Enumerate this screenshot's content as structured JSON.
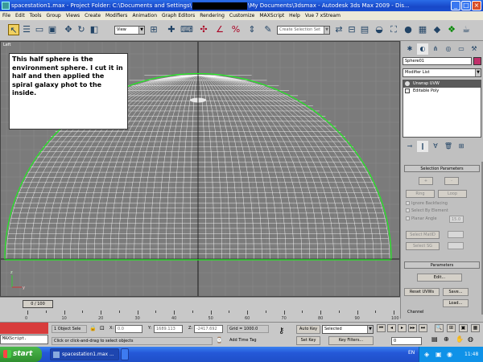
{
  "window": {
    "title_prefix": "spacestation1.max    - Project Folder: C:\\Documents and Settings\\",
    "title_suffix": "\\My Documents\\3dsmax    - Autodesk 3ds Max  2009    - Dis..."
  },
  "menu": [
    "File",
    "Edit",
    "Tools",
    "Group",
    "Views",
    "Create",
    "Modifiers",
    "Animation",
    "Graph Editors",
    "Rendering",
    "Customize",
    "MAXScript",
    "Help",
    "Vue 7 xStream"
  ],
  "toolbar": {
    "ref_coord": "View",
    "named_selection": "Create Selection Set"
  },
  "viewport": {
    "label": "Left",
    "note": "This half sphere is the environment sphere. I cut it in half and then applied the spiral galaxy phot to the inside.",
    "wire_color": "#ffffff",
    "bbox_color": "#22ee22",
    "grid_color": "#8c8c8c",
    "axis_color": "#000000"
  },
  "panel": {
    "object_name": "Sphere01",
    "color_swatch": "#c0306a",
    "modifier_list": "Modifier List",
    "stack": [
      "Unwrap UVW",
      "Editable Poly"
    ],
    "selection_params": "Selection Parameters",
    "ring": "Ring",
    "loop": "Loop",
    "ignore_backfacing": "Ignore Backfacing",
    "select_by_element": "Select By Element",
    "planar_angle": "Planar Angle",
    "planar_value": "15.0",
    "select_matid": "Select MatID",
    "select_sg": "Select SG",
    "parameters": "Parameters",
    "edit": "Edit...",
    "reset_uvws": "Reset UVWs",
    "save": "Save...",
    "load": "Load...",
    "channel": "Channel"
  },
  "timeline": {
    "slider": "0 / 100",
    "ticks": [
      "0",
      "10",
      "20",
      "30",
      "40",
      "50",
      "60",
      "70",
      "80",
      "90",
      "100"
    ]
  },
  "status": {
    "maxscript": "MAXScript.",
    "selection": "1 Object Sele",
    "x_label": "X:",
    "x_value": "0.0",
    "y_label": "Y:",
    "y_value": "1689.113",
    "z_label": "Z:",
    "z_value": "-2417.692",
    "grid": "Grid = 1000.0",
    "auto_key": "Auto Key",
    "set_key": "Set Key",
    "key_mode": "Selected",
    "key_filters": "Key Filters...",
    "prompt": "Click or click-and-drag to select objects",
    "add_time_tag": "Add Time Tag",
    "frame": "0"
  },
  "taskbar": {
    "start": "start",
    "tasks": [
      "spacestation1.max ...",
      ""
    ],
    "lang": "EN",
    "clock": "11:48"
  }
}
